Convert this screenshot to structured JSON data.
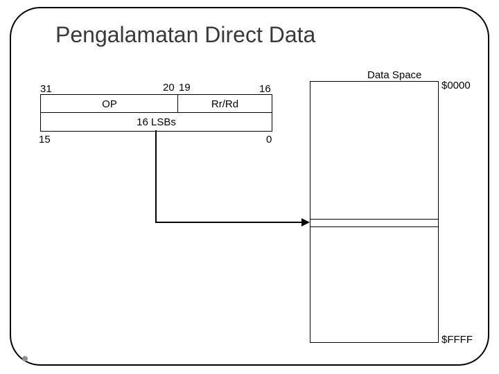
{
  "title": "Pengalamatan Direct Data",
  "bits": {
    "b31": "31",
    "b20": "20",
    "b19": "19",
    "b16": "16",
    "b15": "15",
    "b0": "0"
  },
  "fields": {
    "op": "OP",
    "rrrd": "Rr/Rd",
    "lsbs": "16 LSBs"
  },
  "dataspace": {
    "title": "Data Space",
    "start": "$0000",
    "end": "$FFFF"
  }
}
